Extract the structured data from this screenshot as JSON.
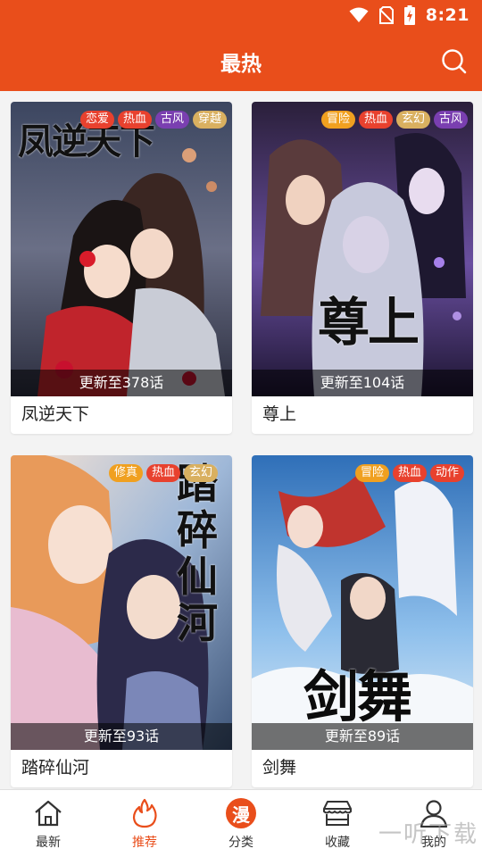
{
  "status_bar": {
    "time": "8:21",
    "icons": [
      "wifi-icon",
      "no-sim-icon",
      "battery-charging-icon"
    ]
  },
  "header": {
    "title": "最热",
    "search_icon": "search-icon"
  },
  "tag_colors": {
    "red": "#e8412e",
    "orange": "#f0a020",
    "purple": "#7a3fb0",
    "beige": "#d9b060"
  },
  "comics": [
    {
      "name": "凤逆天下",
      "update": "更新至378话",
      "title_art": "凤逆天下",
      "tags": [
        "恋爱",
        "热血",
        "古风",
        "穿越"
      ]
    },
    {
      "name": "尊上",
      "update": "更新至104话",
      "title_art": "尊上",
      "tags": [
        "冒险",
        "热血",
        "玄幻",
        "古风"
      ]
    },
    {
      "name": "踏碎仙河",
      "update": "更新至93话",
      "title_art": "踏碎仙河",
      "tags": [
        "修真",
        "热血",
        "玄幻"
      ]
    },
    {
      "name": "剑舞",
      "update": "更新至89话",
      "title_art": "剑舞",
      "tags": [
        "冒险",
        "热血",
        "动作"
      ]
    }
  ],
  "bottom_nav": [
    {
      "label": "最新",
      "icon": "home-icon"
    },
    {
      "label": "推荐",
      "icon": "flame-icon",
      "active": true
    },
    {
      "label": "分类",
      "icon": "man-badge-icon",
      "badge_text": "漫"
    },
    {
      "label": "收藏",
      "icon": "shelf-icon"
    },
    {
      "label": "我的",
      "icon": "user-icon"
    }
  ],
  "watermark": "一听下载"
}
